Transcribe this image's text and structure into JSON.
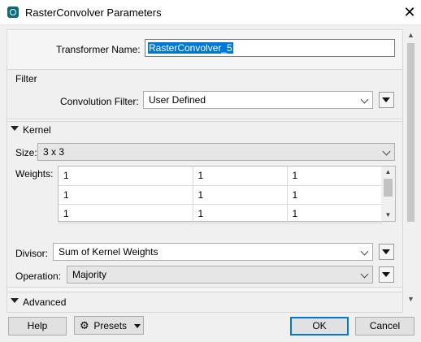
{
  "window": {
    "title": "RasterConvolver Parameters"
  },
  "transformer": {
    "label": "Transformer Name:",
    "value": "RasterConvolver_5"
  },
  "filter": {
    "section_label": "Filter",
    "convolution_label": "Convolution Filter:",
    "convolution_value": "User Defined"
  },
  "kernel": {
    "section_label": "Kernel",
    "size_label": "Size:",
    "size_value": "3 x 3",
    "weights_label": "Weights:",
    "weights": [
      [
        "1",
        "1",
        "1"
      ],
      [
        "1",
        "1",
        "1"
      ],
      [
        "1",
        "1",
        "1"
      ]
    ],
    "divisor_label": "Divisor:",
    "divisor_value": "Sum of Kernel Weights",
    "operation_label": "Operation:",
    "operation_value": "Majority"
  },
  "advanced": {
    "section_label": "Advanced"
  },
  "buttons": {
    "help": "Help",
    "presets": "Presets",
    "ok": "OK",
    "cancel": "Cancel"
  },
  "colors": {
    "selection": "#0078d7",
    "default_button_border": "#0078d7",
    "app_icon": "#0e6b7c"
  },
  "icons": [
    "app-icon",
    "close-icon",
    "expand-triangle-icon",
    "chevron-down-icon",
    "gear-icon",
    "scroll-up-icon",
    "scroll-down-icon"
  ]
}
